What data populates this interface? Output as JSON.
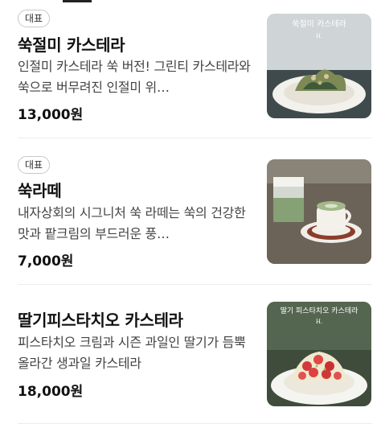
{
  "menu": {
    "items": [
      {
        "badge": "대표",
        "name": "쑥절미 카스테라",
        "desc": "인절미 카스테라 쑥 버전! 그린티 카스테라와 쑥으로 버무려진 인절미 위…",
        "price": "13,000원",
        "thumb_caption": "쑥절미 카스테라",
        "thumb_mark": "H.",
        "image_icon": "castella-plate-image"
      },
      {
        "badge": "대표",
        "name": "쑥라떼",
        "desc": "내자상회의 시그니처 쑥 라떼는 쑥의 건강한 맛과 팥크림의 부드러운 풍…",
        "price": "7,000원",
        "image_icon": "latte-cups-image"
      },
      {
        "badge": "",
        "name": "딸기피스타치오 카스테라",
        "desc": "피스타치오 크림과 시즌 과일인 딸기가 듬뿍 올라간 생과일 카스테라",
        "price": "18,000원",
        "thumb_caption": "딸기 피스타치오 카스테라",
        "thumb_mark": "H.",
        "image_icon": "strawberry-castella-image"
      }
    ]
  },
  "colors": {
    "text_primary": "#111111",
    "text_secondary": "#444444",
    "divider": "#ececec",
    "badge_border": "#c8c8c8"
  }
}
